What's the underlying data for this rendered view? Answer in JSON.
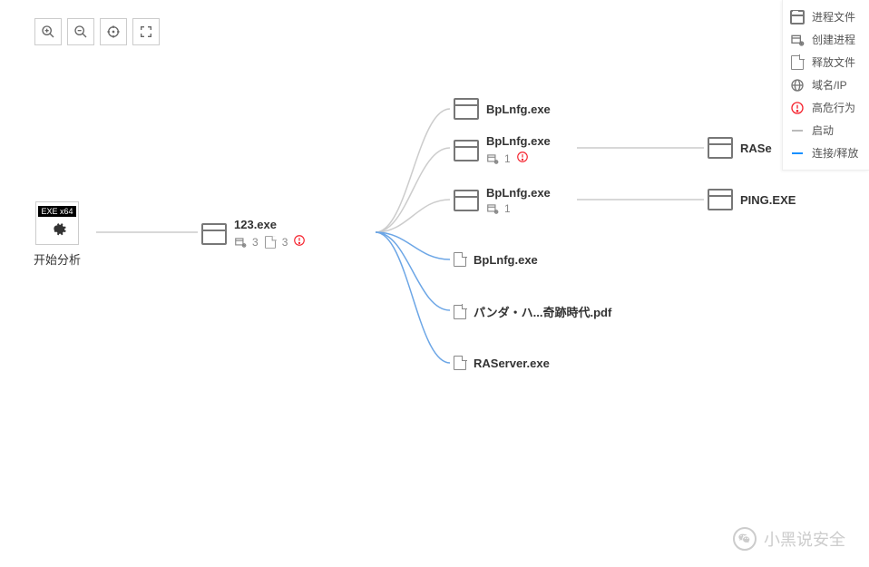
{
  "toolbar": {
    "zoom_in": "zoom-in",
    "zoom_out": "zoom-out",
    "center": "center",
    "fullscreen": "fullscreen"
  },
  "legend": {
    "items": [
      {
        "label": "进程文件",
        "icon": "window"
      },
      {
        "label": "创建进程",
        "icon": "create"
      },
      {
        "label": "释放文件",
        "icon": "file"
      },
      {
        "label": "域名/IP",
        "icon": "globe"
      },
      {
        "label": "高危行为",
        "icon": "danger"
      },
      {
        "label": "启动",
        "icon": "line-gray"
      },
      {
        "label": "连接/释放",
        "icon": "line-blue"
      }
    ]
  },
  "root": {
    "tag": "EXE x64",
    "label": "开始分析"
  },
  "nodes": {
    "n123": {
      "title": "123.exe",
      "create_count": "3",
      "file_count": "3"
    },
    "bp1": {
      "title": "BpLnfg.exe"
    },
    "bp2": {
      "title": "BpLnfg.exe",
      "create_count": "1"
    },
    "bp3": {
      "title": "BpLnfg.exe",
      "create_count": "1"
    },
    "bpfile": {
      "title": "BpLnfg.exe"
    },
    "pdf": {
      "title": "パンダ・ハ...奇跡時代.pdf"
    },
    "raserver": {
      "title": "RAServer.exe"
    },
    "rase": {
      "title": "RASe"
    },
    "ping": {
      "title": "PING.EXE"
    }
  },
  "watermark": {
    "text": "小黑说安全"
  }
}
